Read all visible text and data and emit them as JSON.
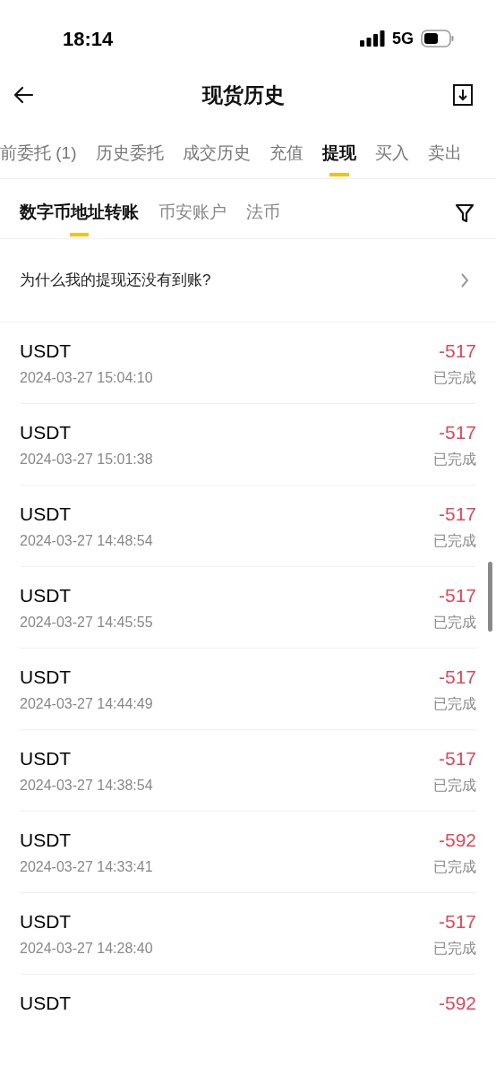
{
  "status_bar": {
    "time": "18:14",
    "network": "5G"
  },
  "header": {
    "title": "现货历史"
  },
  "tabs": [
    {
      "label": "前委托 (1)",
      "selected": false
    },
    {
      "label": "历史委托",
      "selected": false
    },
    {
      "label": "成交历史",
      "selected": false
    },
    {
      "label": "充值",
      "selected": false
    },
    {
      "label": "提现",
      "selected": true
    },
    {
      "label": "买入",
      "selected": false
    },
    {
      "label": "卖出",
      "selected": false
    }
  ],
  "sub_tabs": [
    {
      "label": "数字币地址转账",
      "selected": true
    },
    {
      "label": "币安账户",
      "selected": false
    },
    {
      "label": "法币",
      "selected": false
    }
  ],
  "notice": {
    "text": "为什么我的提现还没有到账?"
  },
  "records": [
    {
      "coin": "USDT",
      "time": "2024-03-27 15:04:10",
      "amount": "-517",
      "status": "已完成"
    },
    {
      "coin": "USDT",
      "time": "2024-03-27 15:01:38",
      "amount": "-517",
      "status": "已完成"
    },
    {
      "coin": "USDT",
      "time": "2024-03-27 14:48:54",
      "amount": "-517",
      "status": "已完成"
    },
    {
      "coin": "USDT",
      "time": "2024-03-27 14:45:55",
      "amount": "-517",
      "status": "已完成"
    },
    {
      "coin": "USDT",
      "time": "2024-03-27 14:44:49",
      "amount": "-517",
      "status": "已完成"
    },
    {
      "coin": "USDT",
      "time": "2024-03-27 14:38:54",
      "amount": "-517",
      "status": "已完成"
    },
    {
      "coin": "USDT",
      "time": "2024-03-27 14:33:41",
      "amount": "-592",
      "status": "已完成"
    },
    {
      "coin": "USDT",
      "time": "2024-03-27 14:28:40",
      "amount": "-517",
      "status": "已完成"
    },
    {
      "coin": "USDT",
      "amount": "-592"
    }
  ]
}
